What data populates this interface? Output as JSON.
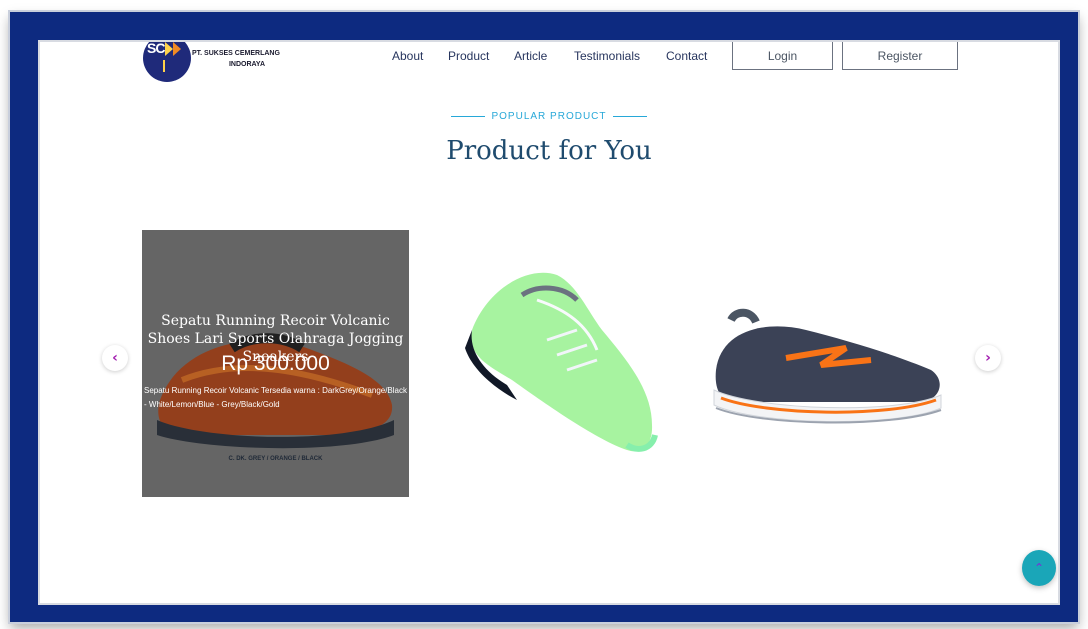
{
  "header": {
    "logo_text": "SC",
    "company_line1": "PT. SUKSES CEMERLANG",
    "company_line2": "INDORAYA",
    "nav": {
      "about": "About",
      "product": "Product",
      "article": "Article",
      "testimonials": "Testimonials",
      "contact": "Contact"
    },
    "login_label": "Login",
    "register_label": "Register"
  },
  "section": {
    "eyebrow": "POPULAR PRODUCT",
    "title": "Product for You"
  },
  "carousel": {
    "prev_icon": "chevron-left-icon",
    "next_icon": "chevron-right-icon",
    "active_card": {
      "name": "Sepatu Running Recoir Volcanic Shoes Lari Sports Olahraga Jogging Sneakers",
      "price": "Rp 300.000",
      "description": "Sepatu Running Recoir Volcanic Tersedia warna : DarkGrey/Orange/Black - White/Lemon/Blue - Grey/Black/Gold",
      "variant": "C. DK. GREY / ORANGE / BLACK"
    }
  },
  "scroll_top_icon": "double-chevron-up-icon",
  "colors": {
    "frame": "#0d2a80",
    "accent": "#27a8d8",
    "heading": "#1f4b6e",
    "arrow": "#a21caf",
    "fab": "#1aa6b8"
  }
}
